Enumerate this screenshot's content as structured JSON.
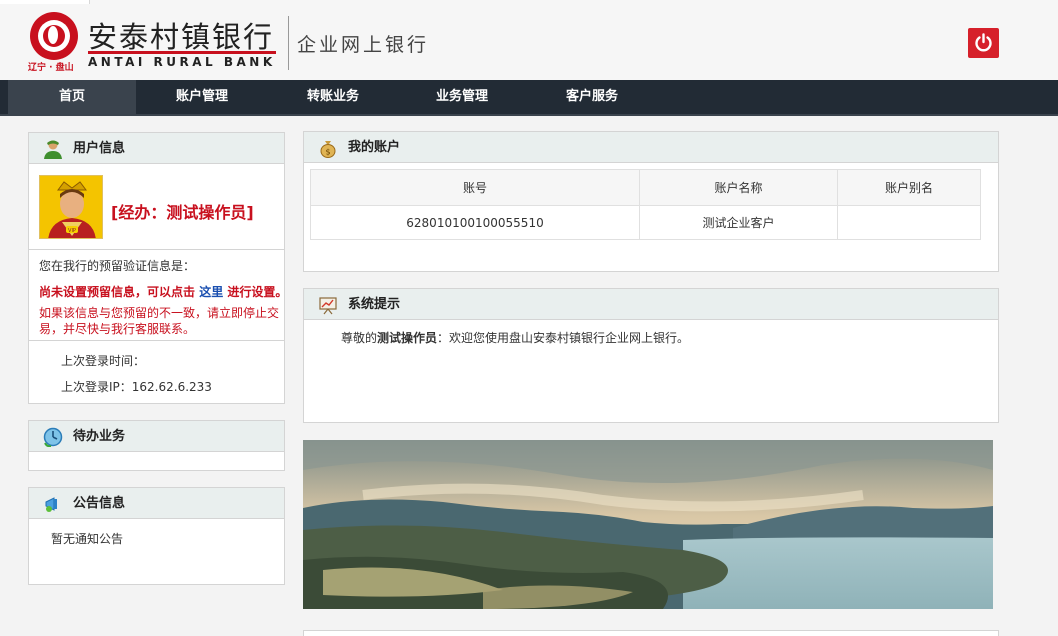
{
  "brand": {
    "name_cn": "安泰村镇银行",
    "name_en": "ANTAI  RURAL  BANK",
    "location": "辽宁 · 盘山",
    "subtitle": "企业网上银行",
    "color": "#c8101e"
  },
  "header": {
    "logout_icon": "power-icon"
  },
  "nav": {
    "items": [
      {
        "label": "首页",
        "active": true
      },
      {
        "label": "账户管理",
        "active": false
      },
      {
        "label": "转账业务",
        "active": false
      },
      {
        "label": "业务管理",
        "active": false
      },
      {
        "label": "客户服务",
        "active": false
      }
    ]
  },
  "user_panel": {
    "title": "用户信息",
    "icon": "user-icon",
    "user_name": "[经办：测试操作员]",
    "reserved_prompt": "您在我行的预留验证信息是：",
    "notice_pre": "尚未设置预留信息，可以点击",
    "notice_link": "这里",
    "notice_post": "进行设置。",
    "warning_line1": "如果该信息与您预留的不一致，请立即停止交",
    "warning_line2": "易，并尽快与我行客服联系。",
    "last_login_time_label": "上次登录时间：",
    "last_login_ip_label": "上次登录IP：",
    "last_login_ip": "162.62.6.233"
  },
  "todo_panel": {
    "title": "待办业务",
    "icon": "clock-icon"
  },
  "notice_panel": {
    "title": "公告信息",
    "icon": "megaphone-icon",
    "empty_text": "暂无通知公告"
  },
  "accounts_panel": {
    "title": "我的账户",
    "icon": "money-bag-icon",
    "columns": [
      "账号",
      "账户名称",
      "账户别名"
    ],
    "rows": [
      {
        "number": "628010100100055510",
        "name": "测试企业客户",
        "alias": ""
      }
    ]
  },
  "system_panel": {
    "title": "系统提示",
    "icon": "presentation-icon",
    "greeting_prefix": "尊敬的",
    "greeting_name": "测试操作员",
    "greeting_suffix": "：欢迎您使用盘山安泰村镇银行企业网上银行。"
  },
  "colors": {
    "nav_bg": "#222b35",
    "nav_active": "#3a434d",
    "panel_head": "#e9efee",
    "link": "#1a4fb0",
    "alert": "#c8101e"
  }
}
